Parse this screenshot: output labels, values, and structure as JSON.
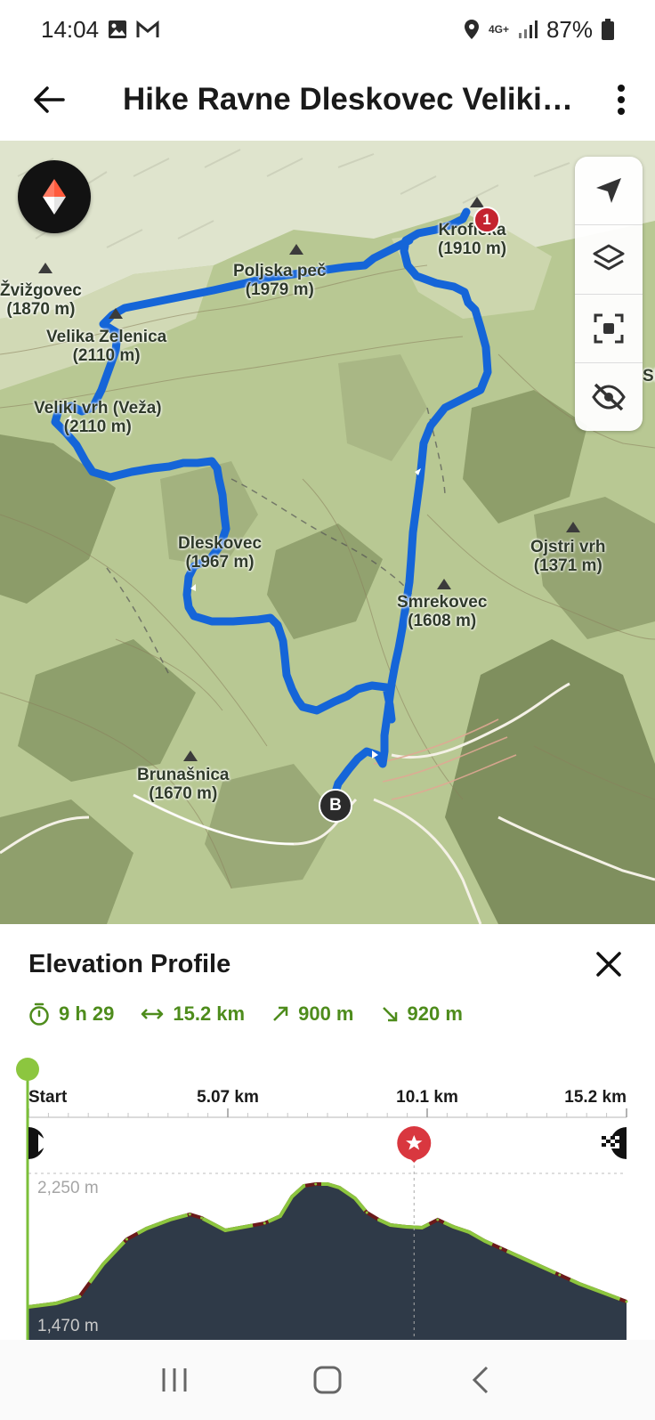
{
  "status_bar": {
    "time": "14:04",
    "network": "4G+",
    "battery": "87%"
  },
  "app_bar": {
    "title": "Hike Ravne Dleskovec Veliki…"
  },
  "map": {
    "peaks": [
      {
        "name": "Žvižgovec",
        "elevation": "(1870 m)"
      },
      {
        "name": "Velika Zelenica",
        "elevation": "(2110 m)"
      },
      {
        "name": "Veliki vrh (Veža)",
        "elevation": "(2110 m)"
      },
      {
        "name": "Poljska peč",
        "elevation": "(1979 m)"
      },
      {
        "name": "Krofička",
        "elevation": "(1910 m)"
      },
      {
        "name": "Dleskovec",
        "elevation": "(1967 m)"
      },
      {
        "name": "Smrekovec",
        "elevation": "(1608 m)"
      },
      {
        "name": "Ojstri vrh",
        "elevation": "(1371 m)"
      },
      {
        "name": "Brunašnica",
        "elevation": "(1670 m)"
      }
    ],
    "marker_highest": "1",
    "marker_end": "B",
    "edge_label": "Sl"
  },
  "elevation_panel": {
    "title": "Elevation Profile",
    "stats": {
      "duration": "9 h 29",
      "distance": "15.2 km",
      "ascent": "900 m",
      "descent": "920 m"
    },
    "axis": {
      "x_labels": [
        "Start",
        "5.07 km",
        "10.1 km",
        "15.2 km"
      ],
      "y_top": "2,250 m",
      "y_bottom": "1,470 m"
    }
  },
  "colors": {
    "route": "#1565d8",
    "accent_green": "#4e8c1c",
    "profile_fill": "#2f3a48",
    "marker_red": "#d9373f"
  },
  "chart_data": {
    "type": "area",
    "title": "Elevation Profile",
    "xlabel": "",
    "ylabel": "",
    "x_unit": "km",
    "y_unit": "m",
    "xlim": [
      0,
      15.2
    ],
    "ylim": [
      1470,
      2250
    ],
    "x": [
      0,
      0.7,
      1.3,
      1.9,
      2.5,
      3.0,
      3.6,
      4.1,
      4.4,
      5.0,
      5.5,
      6.0,
      6.2,
      6.4,
      6.7,
      7.0,
      7.3,
      7.6,
      7.9,
      8.3,
      8.6,
      8.9,
      9.2,
      9.6,
      10.0,
      10.4,
      10.8,
      11.2,
      11.6,
      12.0,
      12.5,
      13.0,
      13.5,
      14.0,
      14.6,
      15.2
    ],
    "y": [
      1500,
      1520,
      1560,
      1740,
      1880,
      1940,
      1990,
      2020,
      2000,
      1930,
      1950,
      1970,
      1990,
      2010,
      2120,
      2180,
      2190,
      2190,
      2170,
      2110,
      2030,
      1990,
      1960,
      1950,
      1945,
      1990,
      1950,
      1920,
      1870,
      1830,
      1780,
      1730,
      1680,
      1630,
      1580,
      1530
    ],
    "grid": true,
    "markers": [
      {
        "label": "start",
        "x": 0
      },
      {
        "label": "highest point",
        "x": 9.8
      },
      {
        "label": "finish",
        "x": 15.2
      }
    ]
  }
}
